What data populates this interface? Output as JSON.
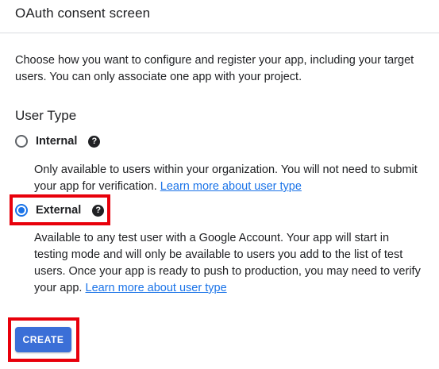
{
  "header": {
    "title": "OAuth consent screen"
  },
  "intro": {
    "text": "Choose how you want to configure and register your app, including your target users. You can only associate one app with your project."
  },
  "user_type": {
    "title": "User Type",
    "options": [
      {
        "label": "Internal",
        "selected": false,
        "help_icon": "help-circle-icon",
        "help_glyph": "?",
        "description": "Only available to users within your organization. You will not need to submit your app for verification.",
        "link_text": "Learn more about user type"
      },
      {
        "label": "External",
        "selected": true,
        "help_icon": "help-circle-icon",
        "help_glyph": "?",
        "description": "Available to any test user with a Google Account. Your app will start in testing mode and will only be available to users you add to the list of test users. Once your app is ready to push to production, you may need to verify your app.",
        "link_text": "Learn more about user type"
      }
    ]
  },
  "actions": {
    "create_label": "CREATE"
  },
  "colors": {
    "accent": "#1a73e8",
    "button": "#3b6fd7",
    "highlight": "#e8000b",
    "text": "#202124"
  }
}
